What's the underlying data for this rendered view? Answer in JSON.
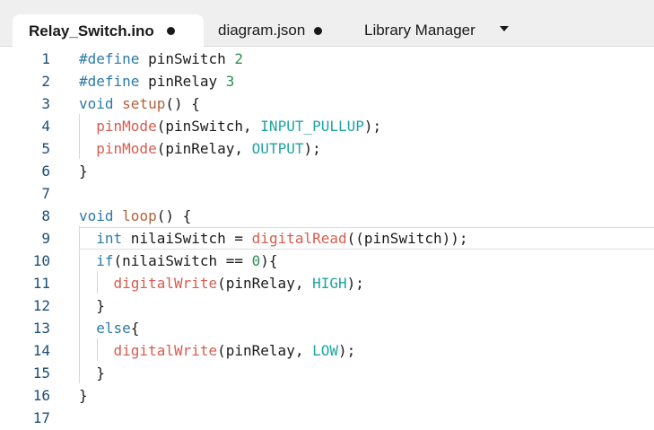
{
  "tabs": [
    {
      "label": "Relay_Switch.ino",
      "active": true,
      "modified": true
    },
    {
      "label": "diagram.json",
      "active": false,
      "modified": true
    },
    {
      "label": "Library Manager",
      "active": false,
      "modified": false
    }
  ],
  "tab_menu_icon": "chevron-down-icon",
  "colors": {
    "keyword": "#2a7aa8",
    "function": "#b3623b",
    "arduino_function": "#d65c4f",
    "constant": "#21a3a3",
    "number": "#2e8b57",
    "line_number": "#1f4e78"
  },
  "editor": {
    "current_line": 9,
    "lines": [
      {
        "n": "1",
        "indent": "",
        "tokens": [
          {
            "t": "#define",
            "c": "kw"
          },
          {
            "t": " pinSwitch ",
            "c": ""
          },
          {
            "t": "2",
            "c": "nm"
          }
        ]
      },
      {
        "n": "2",
        "indent": "",
        "tokens": [
          {
            "t": "#define",
            "c": "kw"
          },
          {
            "t": " pinRelay ",
            "c": ""
          },
          {
            "t": "3",
            "c": "nm"
          }
        ]
      },
      {
        "n": "3",
        "indent": "",
        "tokens": [
          {
            "t": "void",
            "c": "kw"
          },
          {
            "t": " ",
            "c": ""
          },
          {
            "t": "setup",
            "c": "fn"
          },
          {
            "t": "() {",
            "c": ""
          }
        ]
      },
      {
        "n": "4",
        "indent": "  ",
        "tokens": [
          {
            "t": "pinMode",
            "c": "hw"
          },
          {
            "t": "(pinSwitch, ",
            "c": ""
          },
          {
            "t": "INPUT_PULLUP",
            "c": "cn"
          },
          {
            "t": ");",
            "c": ""
          }
        ]
      },
      {
        "n": "5",
        "indent": "  ",
        "tokens": [
          {
            "t": "pinMode",
            "c": "hw"
          },
          {
            "t": "(pinRelay, ",
            "c": ""
          },
          {
            "t": "OUTPUT",
            "c": "cn"
          },
          {
            "t": ");",
            "c": ""
          }
        ]
      },
      {
        "n": "6",
        "indent": "",
        "tokens": [
          {
            "t": "}",
            "c": ""
          }
        ]
      },
      {
        "n": "7",
        "indent": "",
        "tokens": []
      },
      {
        "n": "8",
        "indent": "",
        "tokens": [
          {
            "t": "void",
            "c": "kw"
          },
          {
            "t": " ",
            "c": ""
          },
          {
            "t": "loop",
            "c": "fn"
          },
          {
            "t": "() {",
            "c": ""
          }
        ]
      },
      {
        "n": "9",
        "indent": "  ",
        "tokens": [
          {
            "t": "int",
            "c": "kw"
          },
          {
            "t": " nilaiSwitch = ",
            "c": ""
          },
          {
            "t": "digitalRead",
            "c": "hw"
          },
          {
            "t": "((pinSwitch));",
            "c": ""
          }
        ]
      },
      {
        "n": "10",
        "indent": "  ",
        "tokens": [
          {
            "t": "if",
            "c": "kw"
          },
          {
            "t": "(nilaiSwitch == ",
            "c": ""
          },
          {
            "t": "0",
            "c": "nm"
          },
          {
            "t": "){",
            "c": ""
          }
        ]
      },
      {
        "n": "11",
        "indent": "    ",
        "tokens": [
          {
            "t": "digitalWrite",
            "c": "hw"
          },
          {
            "t": "(pinRelay, ",
            "c": ""
          },
          {
            "t": "HIGH",
            "c": "cn"
          },
          {
            "t": ");",
            "c": ""
          }
        ]
      },
      {
        "n": "12",
        "indent": "  ",
        "tokens": [
          {
            "t": "}",
            "c": ""
          }
        ]
      },
      {
        "n": "13",
        "indent": "  ",
        "tokens": [
          {
            "t": "else",
            "c": "kw"
          },
          {
            "t": "{",
            "c": ""
          }
        ]
      },
      {
        "n": "14",
        "indent": "    ",
        "tokens": [
          {
            "t": "digitalWrite",
            "c": "hw"
          },
          {
            "t": "(pinRelay, ",
            "c": ""
          },
          {
            "t": "LOW",
            "c": "cn"
          },
          {
            "t": ");",
            "c": ""
          }
        ]
      },
      {
        "n": "15",
        "indent": "  ",
        "tokens": [
          {
            "t": "}",
            "c": ""
          }
        ]
      },
      {
        "n": "16",
        "indent": "",
        "tokens": [
          {
            "t": "}",
            "c": ""
          }
        ]
      },
      {
        "n": "17",
        "indent": "",
        "tokens": []
      }
    ]
  }
}
